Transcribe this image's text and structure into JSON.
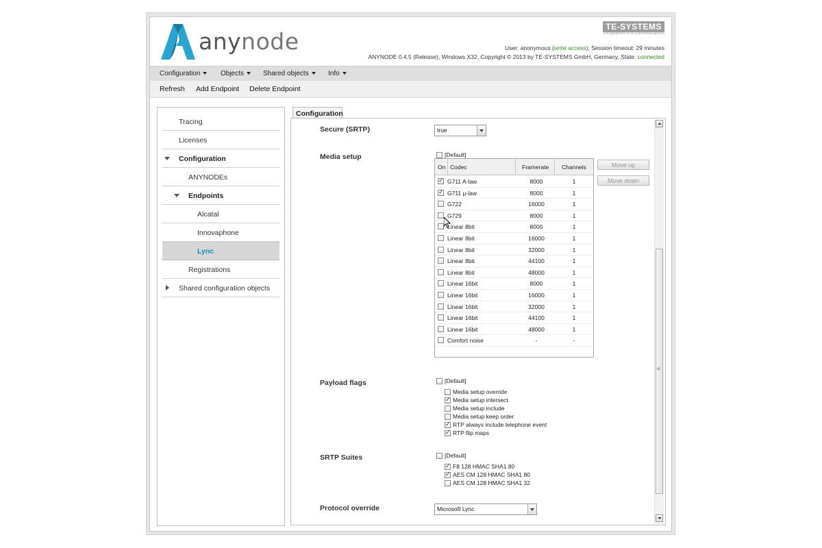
{
  "app": {
    "brand": "anynode",
    "brand_part1": "any",
    "brand_part2": "node",
    "company": "TE-SYSTEMS",
    "company_tagline": "competence in e-communications",
    "user_prefix": "User: anonymous (",
    "user_access": "write access",
    "user_suffix": "), Session timeout: 29 minutes",
    "version_text": "ANYNODE 0.4.5 (Release), Windows X32, Copyright © 2013 by TE-SYSTEMS GmbH, Germany, State: ",
    "state": "connected",
    "colors": {
      "accent": "#1f8bb3",
      "logo": "#2ba3cf",
      "connected": "#2e8b1e"
    }
  },
  "menubar": [
    {
      "label": "Configuration"
    },
    {
      "label": "Objects"
    },
    {
      "label": "Shared objects"
    },
    {
      "label": "Info"
    }
  ],
  "toolbar": {
    "refresh": "Refresh",
    "add": "Add Endpoint",
    "delete": "Delete Endpoint"
  },
  "tree": [
    {
      "label": "Tracing"
    },
    {
      "label": "Licenses"
    },
    {
      "label": "Configuration"
    },
    {
      "label": "ANYNODEs"
    },
    {
      "label": "Endpoints"
    },
    {
      "label": "Alcatal"
    },
    {
      "label": "Innovaphone"
    },
    {
      "label": "Lync",
      "selected": true
    },
    {
      "label": "Registrations"
    },
    {
      "label": "Shared configuration objects"
    }
  ],
  "tab": "Configuration",
  "form": {
    "secure_label": "Secure (SRTP)",
    "secure_value": "true",
    "media_label": "Media setup",
    "default_label": "[Default]",
    "columns": {
      "on": "On",
      "codec": "Codec",
      "framerate": "Framerate",
      "channels": "Channels"
    },
    "codecs": [
      {
        "on": true,
        "codec": "G711 A-law",
        "framerate": "8000",
        "channels": "1"
      },
      {
        "on": true,
        "codec": "G711 µ-law",
        "framerate": "8000",
        "channels": "1"
      },
      {
        "on": false,
        "codec": "G722",
        "framerate": "16000",
        "channels": "1"
      },
      {
        "on": false,
        "codec": "G729",
        "framerate": "8000",
        "channels": "1"
      },
      {
        "on": false,
        "codec": "Linear 8bit",
        "framerate": "8000",
        "channels": "1"
      },
      {
        "on": false,
        "codec": "Linear 8bit",
        "framerate": "16000",
        "channels": "1"
      },
      {
        "on": false,
        "codec": "Linear 8bit",
        "framerate": "32000",
        "channels": "1"
      },
      {
        "on": false,
        "codec": "Linear 8bit",
        "framerate": "44100",
        "channels": "1"
      },
      {
        "on": false,
        "codec": "Linear 8bit",
        "framerate": "48000",
        "channels": "1"
      },
      {
        "on": false,
        "codec": "Linear 16bit",
        "framerate": "8000",
        "channels": "1"
      },
      {
        "on": false,
        "codec": "Linear 16bit",
        "framerate": "16000",
        "channels": "1"
      },
      {
        "on": false,
        "codec": "Linear 16bit",
        "framerate": "32000",
        "channels": "1"
      },
      {
        "on": false,
        "codec": "Linear 16bit",
        "framerate": "44100",
        "channels": "1"
      },
      {
        "on": false,
        "codec": "Linear 16bit",
        "framerate": "48000",
        "channels": "1"
      },
      {
        "on": false,
        "codec": "Comfort noise",
        "framerate": "-",
        "channels": "-"
      }
    ],
    "move_up": "Move up",
    "move_down": "Move down",
    "payload_label": "Payload flags",
    "payload_flags": [
      {
        "label": "Media setup override",
        "on": false
      },
      {
        "label": "Media setup intersect",
        "on": true
      },
      {
        "label": "Media setup include",
        "on": false
      },
      {
        "label": "Media setup keep order",
        "on": false
      },
      {
        "label": "RTP always include telephone event",
        "on": true
      },
      {
        "label": "RTP flip maps",
        "on": true
      }
    ],
    "srtp_label": "SRTP Suites",
    "srtp_suites": [
      {
        "label": "F8 128 HMAC SHA1 80",
        "on": true
      },
      {
        "label": "AES CM 128 HMAC SHA1 80",
        "on": true
      },
      {
        "label": "AES CM 128 HMAC SHA1 32",
        "on": false
      }
    ],
    "protocol_label": "Protocol override",
    "protocol_value": "Microsoft Lync"
  }
}
